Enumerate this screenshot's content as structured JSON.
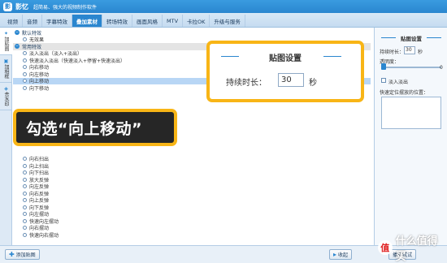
{
  "titlebar": {
    "app_name": "影忆",
    "slogan": "超简易、强大的视频制作软件"
  },
  "tabs": [
    {
      "label": "视频"
    },
    {
      "label": "音频"
    },
    {
      "label": "字幕特效"
    },
    {
      "label": "叠加素材",
      "active": true
    },
    {
      "label": "转场特效"
    },
    {
      "label": "画面风格"
    },
    {
      "label": "MTV"
    },
    {
      "label": "卡拉OK"
    },
    {
      "label": "升级与服务"
    }
  ],
  "side_tabs": [
    {
      "label": "加贴图",
      "active": true
    },
    {
      "label": "加相框"
    },
    {
      "label": "去水印"
    }
  ],
  "list": {
    "group_default": "默认特效",
    "default_items": [
      "无效果"
    ],
    "group_common": "常用特效",
    "items_top": [
      "淡入淡出（淡入+淡出）",
      "快速淡入淡出（快速淡入+停留+快速淡出）",
      "向右移动",
      "向左移动",
      "向上移动",
      "向下移动"
    ],
    "items_bottom": [
      "向右扫出",
      "向上扫出",
      "向下扫出",
      "放大反弹",
      "向左反弹",
      "向右反弹",
      "向上反弹",
      "向下反弹",
      "向左摆动",
      "快速向左摆动",
      "向右摆动",
      "快速向右摆动"
    ]
  },
  "settings_panel": {
    "title": "贴图设置",
    "duration_label": "持续时长：",
    "duration_value": "30",
    "duration_unit": "秒",
    "opacity_label": "透明度：",
    "opacity_value": "0",
    "fade_label": "淡入淡出",
    "position_label": "快速定位摆放的位置："
  },
  "callout_settings": {
    "title": "贴图设置",
    "duration_label": "持续时长：",
    "duration_value": "30",
    "duration_unit": "秒"
  },
  "callout_hint": {
    "text": "勾选“向上移动”"
  },
  "bottom": {
    "add_button": "添加贴图",
    "collapse_button": "收起",
    "preview_button": "播放试试"
  },
  "watermark": {
    "text": "什么值得买",
    "badge": "值"
  },
  "colors": {
    "accent": "#2a86cf",
    "highlight": "#f8b516",
    "dark_callout": "#262626",
    "selected_row": "#b8d6f5"
  }
}
